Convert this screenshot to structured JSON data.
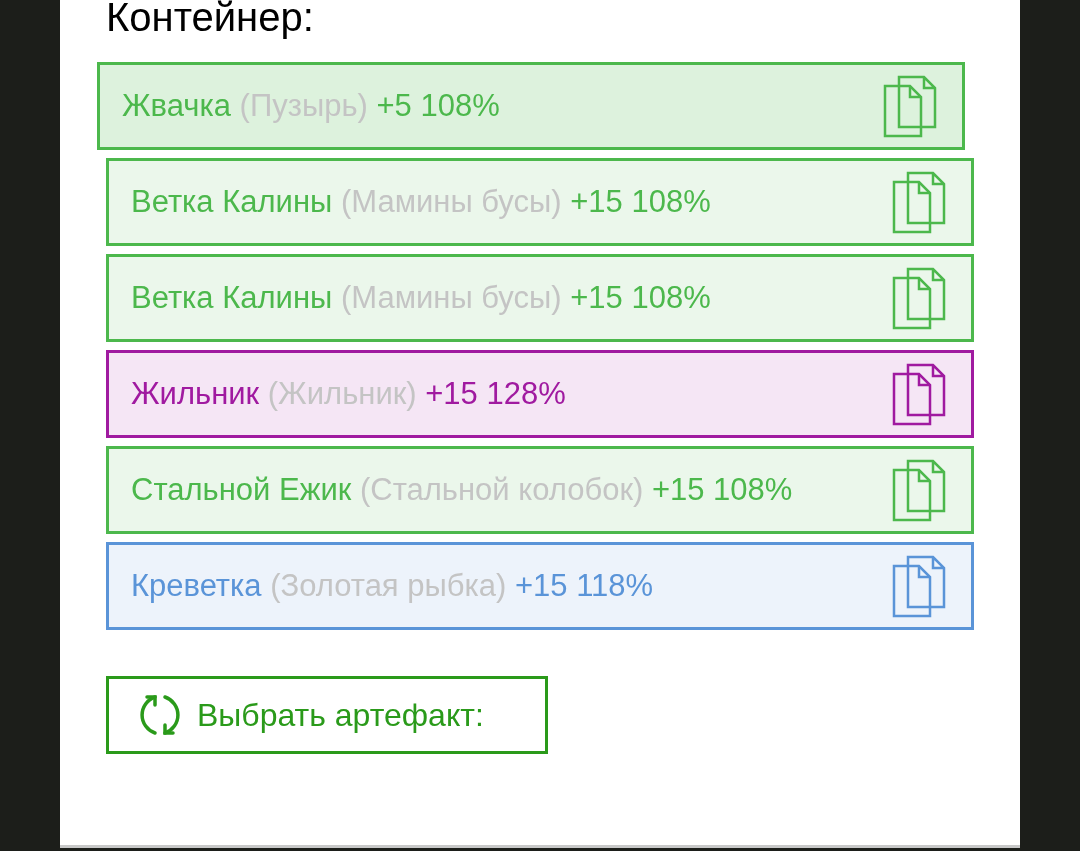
{
  "heading": "Контейнер:",
  "artifacts": [
    {
      "name": "Жвачка",
      "origin": "(Пузырь)",
      "bonus": "+5 108%",
      "color": "#4cb84c",
      "selected": true
    },
    {
      "name": "Ветка Калины",
      "origin": "(Мамины бусы)",
      "bonus": "+15 108%",
      "color": "#4cb84c",
      "selected": false
    },
    {
      "name": "Ветка Калины",
      "origin": "(Мамины бусы)",
      "bonus": "+15 108%",
      "color": "#4cb84c",
      "selected": false
    },
    {
      "name": "Жильник",
      "origin": "(Жильник)",
      "bonus": "+15 128%",
      "color": "#a01aa0",
      "selected": false
    },
    {
      "name": "Стальной Ежик",
      "origin": "(Стальной колобок)",
      "bonus": "+15 108%",
      "color": "#4cb84c",
      "selected": false
    },
    {
      "name": "Креветка",
      "origin": "(Золотая рыбка)",
      "bonus": "+15 118%",
      "color": "#5a94d8",
      "selected": false
    }
  ],
  "choose_button": "Выбрать артефакт:"
}
